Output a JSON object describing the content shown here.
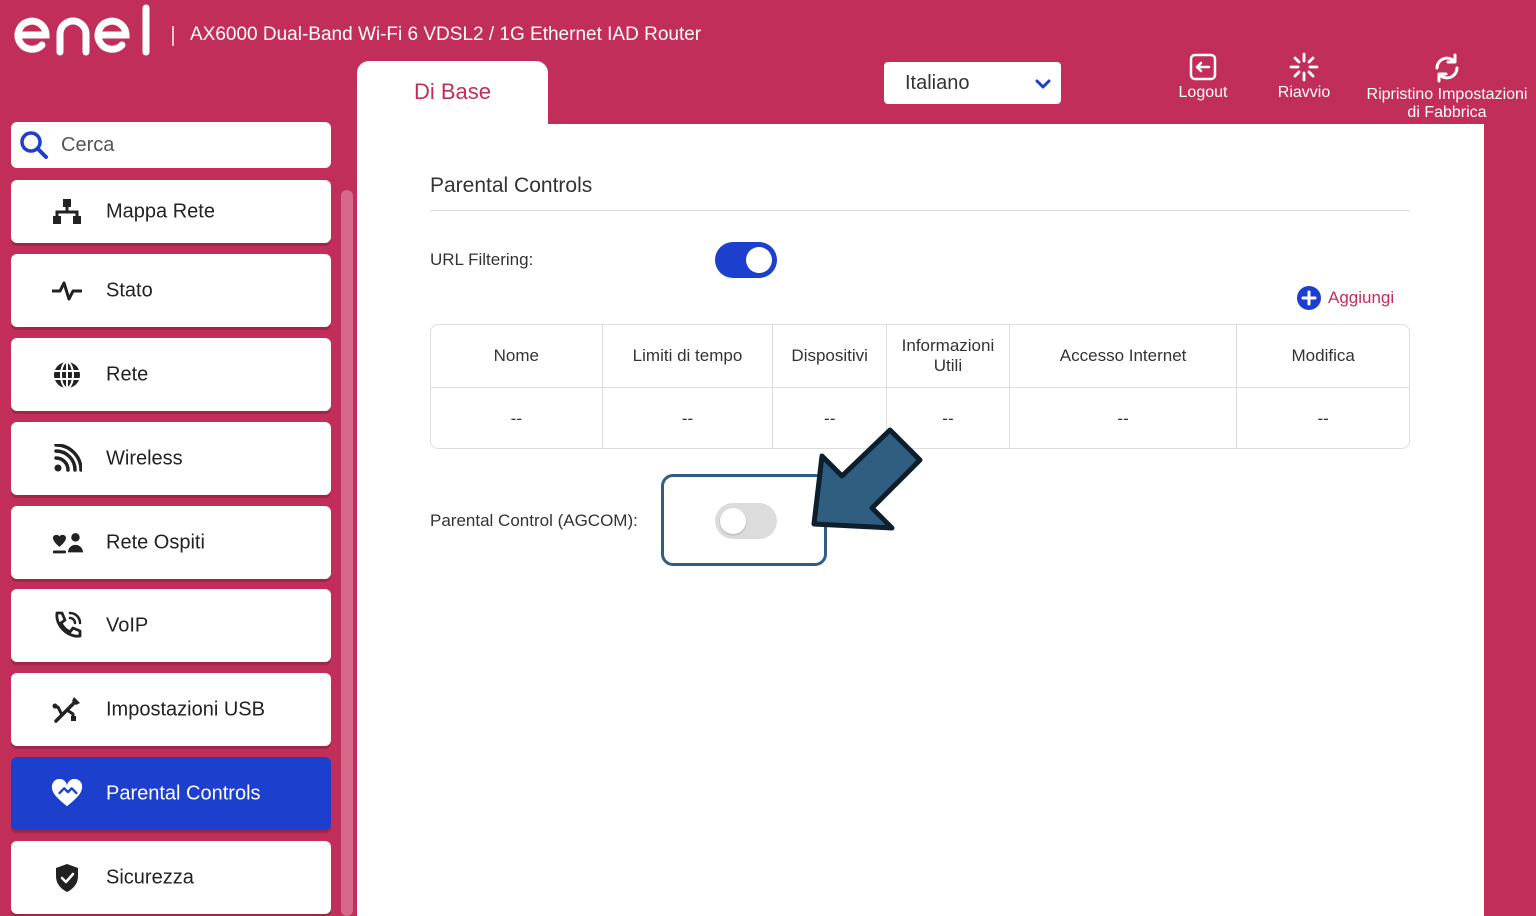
{
  "header": {
    "logo_text": "enel",
    "router_title": "AX6000 Dual-Band Wi-Fi 6 VDSL2 / 1G Ethernet IAD Router",
    "tab_label": "Di Base",
    "language": "Italiano",
    "actions": {
      "logout": "Logout",
      "reboot": "Riavvio",
      "reset_line1": "Ripristino Impostazioni",
      "reset_line2": "di Fabbrica"
    }
  },
  "sidebar": {
    "search_placeholder": "Cerca",
    "items": [
      {
        "label": "Mappa Rete",
        "icon": "network-map-icon"
      },
      {
        "label": "Stato",
        "icon": "pulse-icon"
      },
      {
        "label": "Rete",
        "icon": "globe-icon"
      },
      {
        "label": "Wireless",
        "icon": "wireless-icon"
      },
      {
        "label": "Rete Ospiti",
        "icon": "guests-icon"
      },
      {
        "label": "VoIP",
        "icon": "phone-icon"
      },
      {
        "label": "Impostazioni USB",
        "icon": "usb-icon"
      },
      {
        "label": "Parental Controls",
        "icon": "heart-icon",
        "active": true
      },
      {
        "label": "Sicurezza",
        "icon": "shield-icon"
      }
    ]
  },
  "main": {
    "section_title": "Parental Controls",
    "url_filtering_label": "URL Filtering:",
    "url_filtering_enabled": true,
    "add_label": "Aggiungi",
    "table": {
      "headers": [
        "Nome",
        "Limiti di tempo",
        "Dispositivi",
        "Informazioni Utili",
        "Accesso Internet",
        "Modifica"
      ],
      "rows": [
        [
          "--",
          "--",
          "--",
          "--",
          "--",
          "--"
        ]
      ]
    },
    "agcom_label": "Parental Control (AGCOM):",
    "agcom_enabled": false
  },
  "colors": {
    "brand": "#c22e5a",
    "accent": "#1c3fce",
    "highlight": "#2f5e80"
  }
}
